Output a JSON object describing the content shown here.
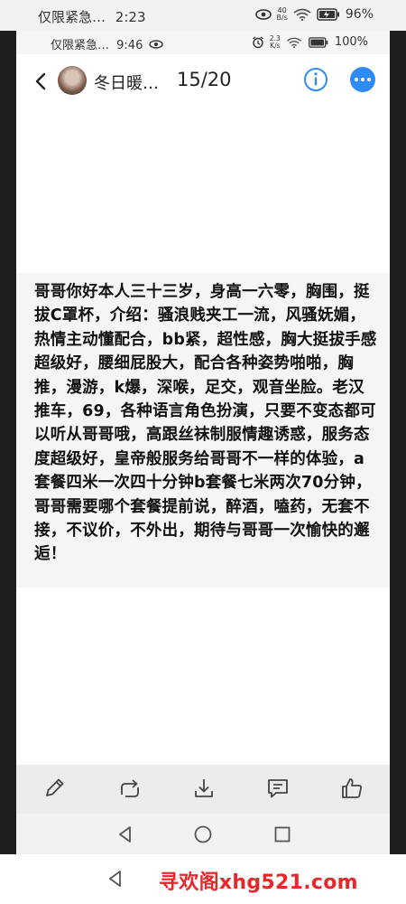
{
  "outer_status": {
    "carrier": "仅限紧急…",
    "time": "2:23",
    "net_speed_top": "40",
    "net_speed_unit": "B/s",
    "battery": "96%"
  },
  "inner_status": {
    "carrier": "仅限紧急…",
    "time": "9:46",
    "net_speed_top": "2.3",
    "net_speed_unit": "K/s",
    "battery": "100%"
  },
  "header": {
    "contact_name": "冬日暖…",
    "page_counter": "15/20"
  },
  "post": {
    "text": "哥哥你好本人三十三岁，身高一六零，胸围，挺拔C罩杯，介绍：骚浪贱夹工一流，风骚妩媚，热情主动懂配合，bb紧，超性感，胸大挺拔手感超级好，腰细屁股大，配合各种姿势啪啪，胸推，漫游，k爆，深喉，足交，观音坐脸。老汉推车，69，各种语言角色扮演，只要不变态都可以听从哥哥哦，高跟丝袜制服情趣诱惑，服务态度超级好，皇帝般服务给哥哥不一样的体验，a套餐四米一次四十分钟b套餐七米两次70分钟，哥哥需要哪个套餐提前说，醉酒，嗑药，无套不接，不议价，不外出，期待与哥哥一次愉快的邂逅！"
  },
  "watermark": {
    "text": "寻欢阁xhg521.com"
  },
  "colors": {
    "accent": "#2f8cf6",
    "watermark": "#e8262b"
  }
}
